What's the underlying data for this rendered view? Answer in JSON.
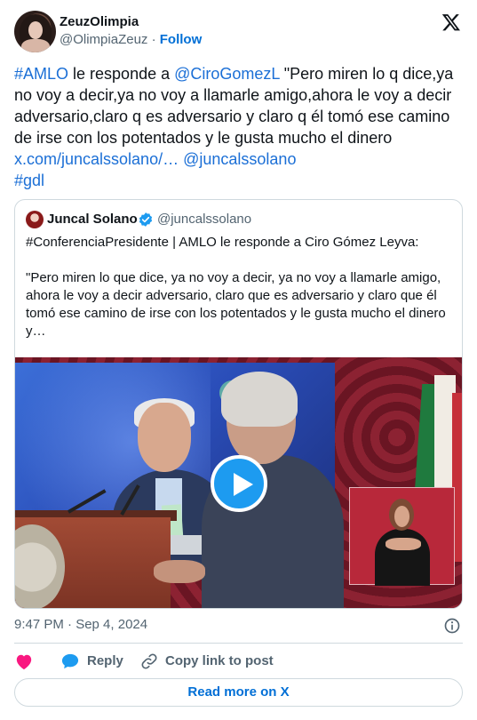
{
  "author": {
    "name": "ZeuzOlimpia",
    "handle": "@OlimpiaZeuz",
    "separator": "·",
    "follow_label": "Follow"
  },
  "tweet": {
    "hashtag_1": "#AMLO",
    "text_1": " le responde a ",
    "mention": "@CiroGomezL",
    "text_2": "  \"Pero miren lo q dice,ya no voy a decir,ya no voy a llamarle amigo,ahora le voy a decir adversario,claro q es adversario y claro q él tomó ese camino de irse con los potentados y le gusta mucho el dinero ",
    "link": "x.com/juncalssolano/…",
    "mention_2": "@juncalssolano",
    "hashtag_2": "#gdl"
  },
  "quote": {
    "name": "Juncal Solano",
    "handle": "@juncalssolano",
    "line_1": "#ConferenciaPresidente | AMLO le responde a Ciro Gómez Leyva:",
    "line_2": "\"Pero miren lo que dice, ya no voy a decir, ya no voy a llamarle amigo, ahora le voy a decir adversario, claro que es adversario y claro que él tomó ese camino de irse con los potentados y le gusta mucho el dinero y…"
  },
  "meta": {
    "timestamp": "9:47 PM · Sep 4, 2024"
  },
  "actions": {
    "reply_label": "Reply",
    "copy_label": "Copy link to post"
  },
  "footer": {
    "read_more_label": "Read more on X"
  },
  "icons": {
    "logo": "x-logo-icon",
    "verified": "verified-badge-icon",
    "play": "play-icon",
    "info": "info-icon",
    "like": "heart-icon",
    "reply": "speech-bubble-icon",
    "copy": "link-icon"
  },
  "colors": {
    "link": "#1b6fd6",
    "accent": "#1d9bf0",
    "heart": "#f91880",
    "muted": "#536471"
  }
}
